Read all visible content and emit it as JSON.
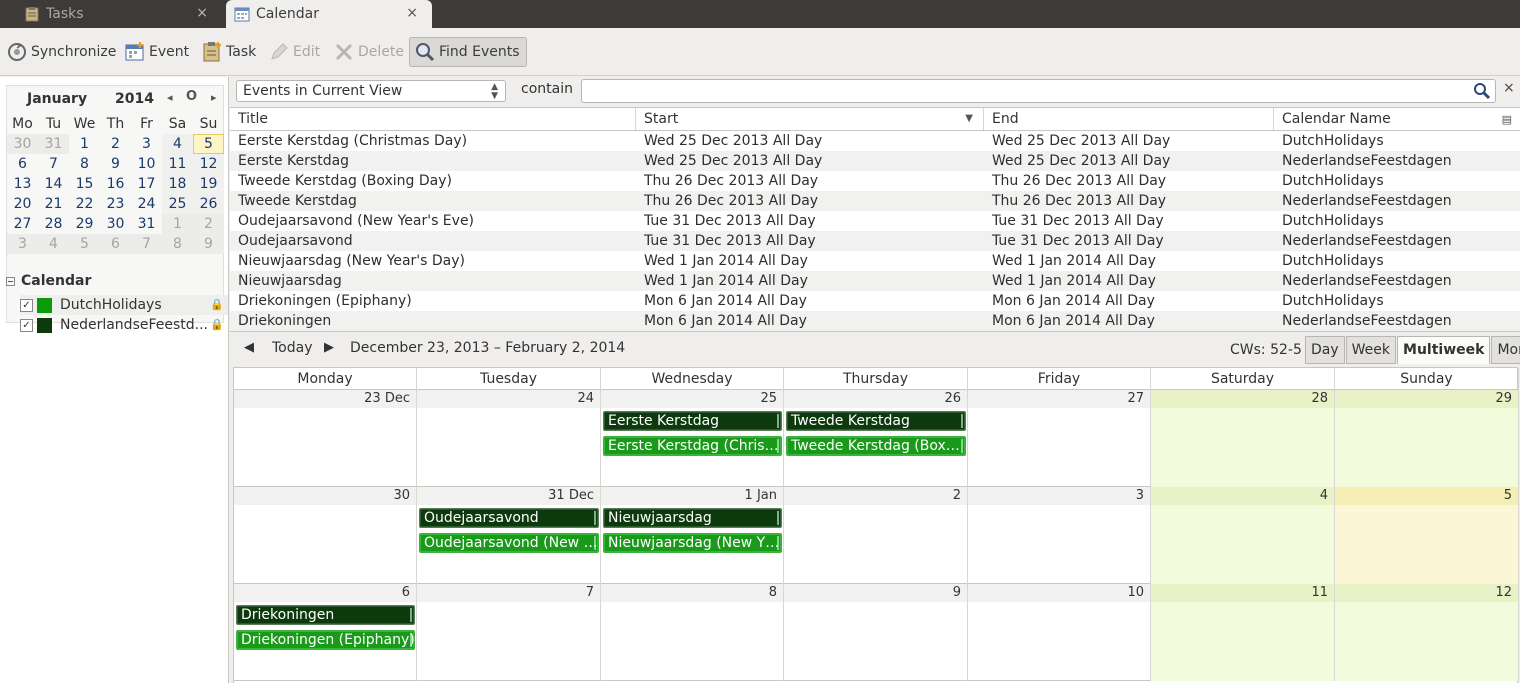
{
  "tabs": [
    {
      "label": "Tasks",
      "close": "×"
    },
    {
      "label": "Calendar",
      "close": "×"
    }
  ],
  "toolbar": {
    "synchronize": "Synchronize",
    "event": "Event",
    "task": "Task",
    "edit": "Edit",
    "delete": "Delete",
    "find_events": "Find Events"
  },
  "minimonth": {
    "month": "January",
    "year": "2014",
    "prev": "◂",
    "today": "O",
    "next": "▸",
    "weekdays": [
      "Mo",
      "Tu",
      "We",
      "Th",
      "Fr",
      "Sa",
      "Su"
    ],
    "weeks": [
      [
        "30",
        "31",
        "1",
        "2",
        "3",
        "4",
        "5"
      ],
      [
        "6",
        "7",
        "8",
        "9",
        "10",
        "11",
        "12"
      ],
      [
        "13",
        "14",
        "15",
        "16",
        "17",
        "18",
        "19"
      ],
      [
        "20",
        "21",
        "22",
        "23",
        "24",
        "25",
        "26"
      ],
      [
        "27",
        "28",
        "29",
        "30",
        "31",
        "1",
        "2"
      ],
      [
        "3",
        "4",
        "5",
        "6",
        "7",
        "8",
        "9"
      ]
    ]
  },
  "calendar_list": {
    "heading": "Calendar",
    "items": [
      {
        "name": "DutchHolidays",
        "color": "#0a9a0a",
        "checked": "✓"
      },
      {
        "name": "NederlandseFeestd...",
        "color": "#0b3a0b",
        "checked": "✓"
      }
    ]
  },
  "search": {
    "filter": "Events in Current View",
    "contain_label": "contain",
    "query": "",
    "clear": "×"
  },
  "event_list": {
    "columns": [
      "Title",
      "Start",
      "End",
      "Calendar Name"
    ],
    "rows": [
      [
        "Eerste Kerstdag (Christmas Day)",
        "Wed 25 Dec 2013 All Day",
        "Wed 25 Dec 2013 All Day",
        "DutchHolidays"
      ],
      [
        "Eerste Kerstdag",
        "Wed 25 Dec 2013 All Day",
        "Wed 25 Dec 2013 All Day",
        "NederlandseFeestdagen"
      ],
      [
        "Tweede Kerstdag (Boxing Day)",
        "Thu 26 Dec 2013 All Day",
        "Thu 26 Dec 2013 All Day",
        "DutchHolidays"
      ],
      [
        "Tweede Kerstdag",
        "Thu 26 Dec 2013 All Day",
        "Thu 26 Dec 2013 All Day",
        "NederlandseFeestdagen"
      ],
      [
        "Oudejaarsavond (New Year's Eve)",
        "Tue 31 Dec 2013 All Day",
        "Tue 31 Dec 2013 All Day",
        "DutchHolidays"
      ],
      [
        "Oudejaarsavond",
        "Tue 31 Dec 2013 All Day",
        "Tue 31 Dec 2013 All Day",
        "NederlandseFeestdagen"
      ],
      [
        "Nieuwjaarsdag (New Year's Day)",
        "Wed 1 Jan 2014 All Day",
        "Wed 1 Jan 2014 All Day",
        "DutchHolidays"
      ],
      [
        "Nieuwjaarsdag",
        "Wed 1 Jan 2014 All Day",
        "Wed 1 Jan 2014 All Day",
        "NederlandseFeestdagen"
      ],
      [
        "Driekoningen (Epiphany)",
        "Mon 6 Jan 2014 All Day",
        "Mon 6 Jan 2014 All Day",
        "DutchHolidays"
      ],
      [
        "Driekoningen",
        "Mon 6 Jan 2014 All Day",
        "Mon 6 Jan 2014 All Day",
        "NederlandseFeestdagen"
      ]
    ]
  },
  "nav": {
    "prev": "◀",
    "today": "Today",
    "next": "▶",
    "range": "December 23, 2013 – February 2, 2014",
    "cws": "CWs: 52-5",
    "views": [
      "Day",
      "Week",
      "Multiweek",
      "Month"
    ],
    "active_view": "Multiweek"
  },
  "multiweek": {
    "day_names": [
      "Monday",
      "Tuesday",
      "Wednesday",
      "Thursday",
      "Friday",
      "Saturday",
      "Sunday"
    ],
    "weeks": [
      {
        "days": [
          "23 Dec",
          "24",
          "25",
          "26",
          "27",
          "28",
          "29"
        ],
        "events": [
          {
            "day": 2,
            "slot": 0,
            "title": "Eerste Kerstdag",
            "style": "dark"
          },
          {
            "day": 2,
            "slot": 1,
            "title": "Eerste Kerstdag (Chris…",
            "style": "light"
          },
          {
            "day": 3,
            "slot": 0,
            "title": "Tweede Kerstdag",
            "style": "dark"
          },
          {
            "day": 3,
            "slot": 1,
            "title": "Tweede Kerstdag (Box…",
            "style": "light"
          }
        ]
      },
      {
        "days": [
          "30",
          "31 Dec",
          "1 Jan",
          "2",
          "3",
          "4",
          "5"
        ],
        "events": [
          {
            "day": 1,
            "slot": 0,
            "title": "Oudejaarsavond",
            "style": "dark"
          },
          {
            "day": 1,
            "slot": 1,
            "title": "Oudejaarsavond (New …",
            "style": "light"
          },
          {
            "day": 2,
            "slot": 0,
            "title": "Nieuwjaarsdag",
            "style": "dark"
          },
          {
            "day": 2,
            "slot": 1,
            "title": "Nieuwjaarsdag (New Y…",
            "style": "light"
          }
        ]
      },
      {
        "days": [
          "6",
          "7",
          "8",
          "9",
          "10",
          "11",
          "12"
        ],
        "events": [
          {
            "day": 0,
            "slot": 0,
            "title": "Driekoningen",
            "style": "dark"
          },
          {
            "day": 0,
            "slot": 1,
            "title": "Driekoningen (Epiphany)",
            "style": "light"
          }
        ]
      }
    ]
  }
}
